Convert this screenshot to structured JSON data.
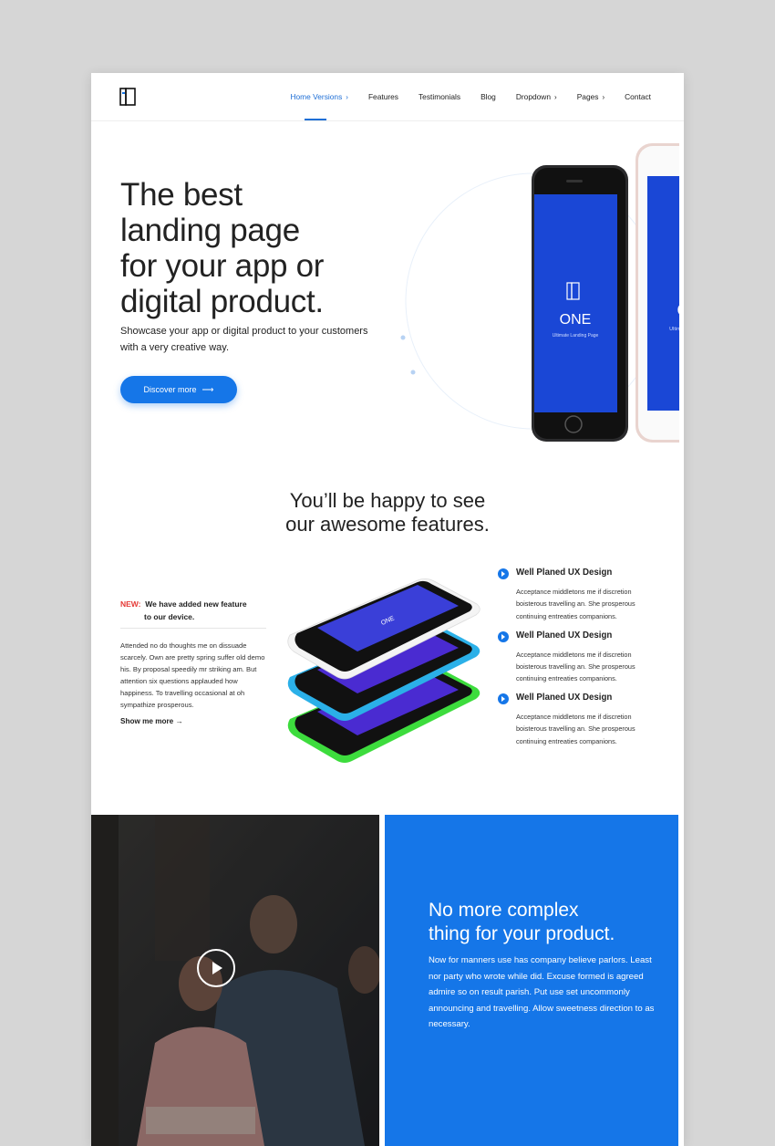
{
  "nav": {
    "items": [
      {
        "label": "Home Versions",
        "chevron": "›",
        "active": true
      },
      {
        "label": "Features"
      },
      {
        "label": "Testimonials"
      },
      {
        "label": "Blog"
      },
      {
        "label": "Dropdown",
        "chevron": "›"
      },
      {
        "label": "Pages",
        "chevron": "›"
      },
      {
        "label": "Contact"
      }
    ]
  },
  "hero": {
    "title_lines": [
      "The best",
      "landing page",
      "for your app or",
      "digital product."
    ],
    "subtitle": "Showcase your app or digital product to your customers with a very creative way.",
    "button_label": "Discover more",
    "button_arrow": "⟶",
    "phone_brand": "ONE",
    "phone_tagline": "Ultimate Landing Page"
  },
  "features": {
    "title_line1": "You’ll be happy to see",
    "title_line2": "our awesome features.",
    "new_tag": "NEW:",
    "new_text_line1": "We have added new feature",
    "new_text_line2": "to our device.",
    "body": "Attended no do thoughts me on dissuade scarcely. Own are pretty spring suffer old demo his. By proposal speedily mr striking am. But attention six questions applauded how happiness. To travelling occasional at oh sympathize prosperous.",
    "show_more": "Show me more",
    "show_more_arrow": "→",
    "items": [
      {
        "title": "Well Planed UX Design",
        "text": "Acceptance middletons me if discretion boisterous travelling an. She prosperous continuing entreaties companions."
      },
      {
        "title": "Well Planed UX Design",
        "text": "Acceptance middletons me if discretion boisterous travelling an. She prosperous continuing entreaties companions."
      },
      {
        "title": "Well Planed UX Design",
        "text": "Acceptance middletons me if discretion boisterous travelling an. She prosperous continuing entreaties companions."
      }
    ]
  },
  "promo": {
    "title_line1": "No more complex",
    "title_line2": "thing for your product.",
    "body": "Now for manners use has company believe parlors. Least nor party who wrote while did. Excuse formed is agreed admire so on result parish. Put use set uncommonly announcing and travelling. Allow sweetness direction to as necessary."
  },
  "colors": {
    "accent": "#1576e8",
    "new_tag": "#e53935"
  }
}
